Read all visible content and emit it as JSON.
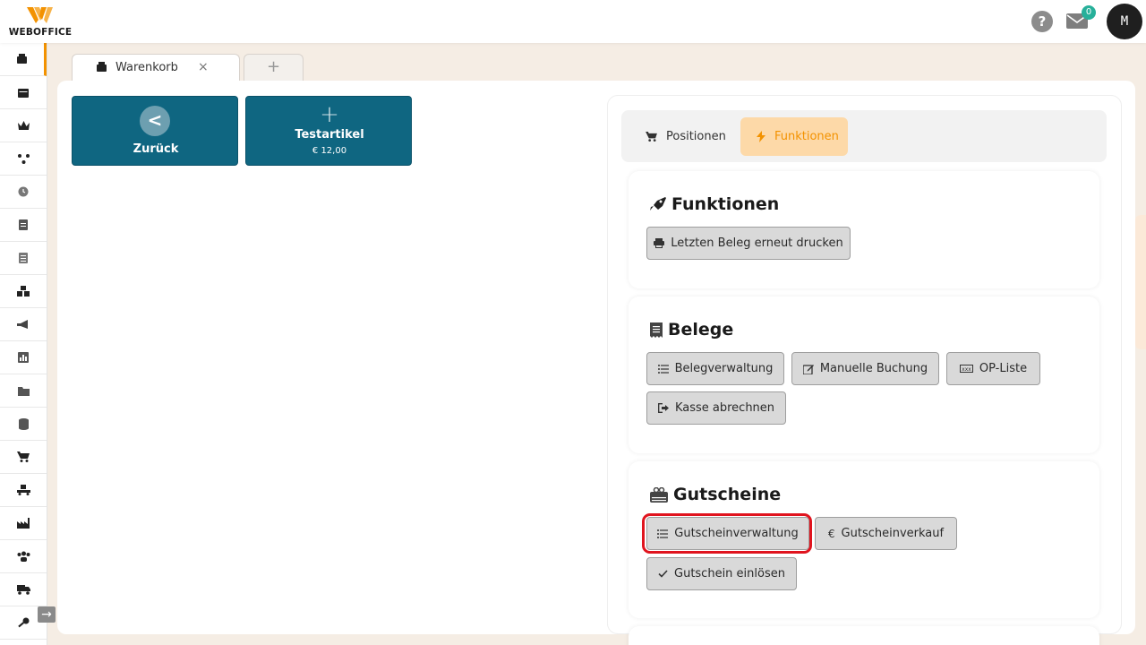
{
  "header": {
    "brand": "WEBOFFICE",
    "help_label": "?",
    "mail_badge": "0",
    "avatar_initial": "M"
  },
  "sidebar": {
    "items": [
      {
        "icon": "register-icon",
        "active": true
      },
      {
        "icon": "calendar-icon"
      },
      {
        "icon": "crown-icon"
      },
      {
        "icon": "network-icon"
      },
      {
        "icon": "clock-icon"
      },
      {
        "icon": "document-icon"
      },
      {
        "icon": "list-document-icon"
      },
      {
        "icon": "boxes-icon"
      },
      {
        "icon": "megaphone-icon"
      },
      {
        "icon": "chart-icon"
      },
      {
        "icon": "folder-icon"
      },
      {
        "icon": "database-icon"
      },
      {
        "icon": "cart-icon"
      },
      {
        "icon": "dolly-icon"
      },
      {
        "icon": "factory-icon"
      },
      {
        "icon": "users-icon"
      },
      {
        "icon": "truck-icon"
      },
      {
        "icon": "key-icon"
      }
    ],
    "expand_label": "→"
  },
  "tabs": {
    "active_label": "Warenkorb",
    "close_label": "×",
    "add_label": "+"
  },
  "tiles": {
    "back_label": "Zurück",
    "back_icon": "<",
    "test_plus": "+",
    "test_label": "Testartikel",
    "test_price": "€ 12,00"
  },
  "right_panel": {
    "tab_positionen": "Positionen",
    "tab_funktionen": "Funktionen",
    "funktionen": {
      "title": "Funktionen",
      "reprint_label": "Letzten Beleg erneut drucken"
    },
    "belege": {
      "title": "Belege",
      "belegverwaltung_label": "Belegverwaltung",
      "manuelle_buchung_label": "Manuelle Buchung",
      "op_liste_label": "OP-Liste",
      "kasse_abrechnen_label": "Kasse abrechnen"
    },
    "gutscheine": {
      "title": "Gutscheine",
      "verwaltung_label": "Gutscheinverwaltung",
      "verkauf_label": "Gutscheinverkauf",
      "einloesen_label": "Gutschein einlösen"
    }
  },
  "colors": {
    "accent": "#f39200",
    "tile": "#0f6681",
    "highlight": "#e0141e",
    "badge": "#27b09a"
  }
}
